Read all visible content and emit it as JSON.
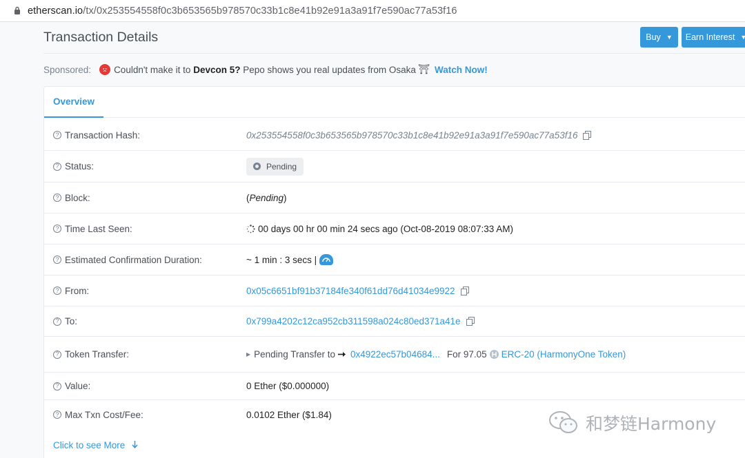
{
  "browser": {
    "url_host": "etherscan.io",
    "url_path": "/tx/0x253554558f0c3b653565b978570c33b1c8e41b92e91a3a91f7e590ac77a53f16"
  },
  "header": {
    "title": "Transaction Details",
    "buy_label": "Buy",
    "earn_label": "Earn Interest"
  },
  "sponsored": {
    "label": "Sponsored:",
    "text_pre": "Couldn't make it to ",
    "text_bold": "Devcon 5?",
    "text_post": " Pepo shows you real updates from Osaka ",
    "torii": "⛩",
    "link": "Watch Now!"
  },
  "tabs": {
    "overview": "Overview"
  },
  "details": {
    "hash_label": "Transaction Hash:",
    "hash_value": "0x253554558f0c3b653565b978570c33b1c8e41b92e91a3a91f7e590ac77a53f16",
    "status_label": "Status:",
    "status_value": "Pending",
    "block_label": "Block:",
    "block_value_open": "(",
    "block_value": "Pending",
    "block_value_close": ")",
    "time_label": "Time Last Seen:",
    "time_value": "00 days 00 hr 00 min 24 secs ago (Oct-08-2019 08:07:33 AM)",
    "duration_label": "Estimated Confirmation Duration:",
    "duration_value": "~ 1 min : 3 secs |",
    "from_label": "From:",
    "from_value": "0x05c6651bf91b37184fe340f61dd76d41034e9922",
    "to_label": "To:",
    "to_value": "0x799a4202c12ca952cb311598a024c80ed371a41e",
    "token_label": "Token Transfer:",
    "token_pending": "Pending Transfer to",
    "token_to": "0x4922ec57b04684...",
    "token_for": "For 97.05",
    "token_name": "ERC-20 (HarmonyOne Token)",
    "value_label": "Value:",
    "value_value": "0 Ether ($0.000000)",
    "fee_label": "Max Txn Cost/Fee:",
    "fee_value": "0.0102 Ether ($1.84)"
  },
  "more_link": "Click to see More",
  "watermark": "和梦链Harmony",
  "colors": {
    "accent": "#3498db",
    "text": "#1e2022",
    "muted": "#77838f"
  }
}
